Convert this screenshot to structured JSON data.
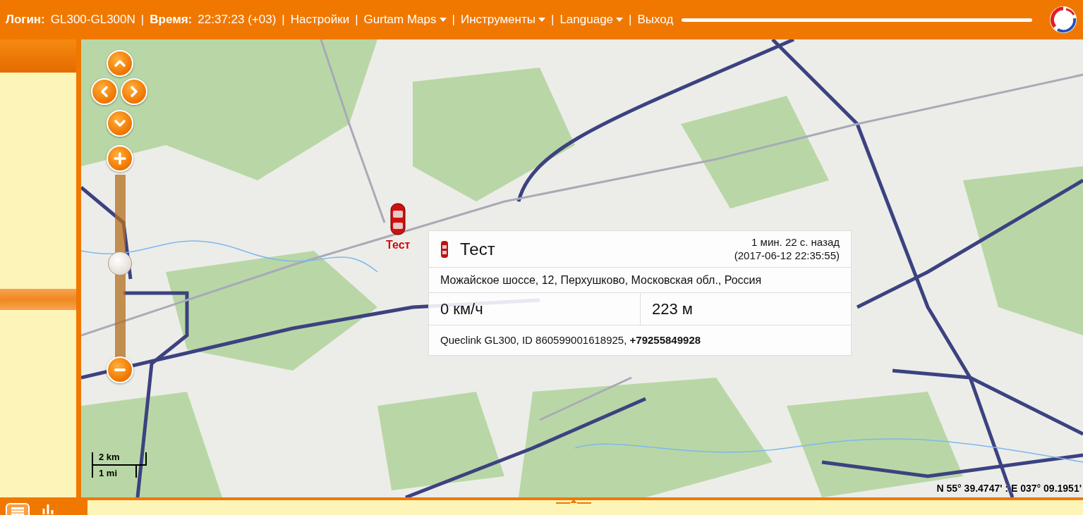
{
  "topbar": {
    "login_label": "Логин:",
    "login": "GL300-GL300N",
    "separator": "|",
    "time_label": "Время:",
    "time": "22:37:23 (+03)",
    "menu": [
      {
        "label": "Настройки",
        "dropdown": false
      },
      {
        "label": "Gurtam Maps",
        "dropdown": true
      },
      {
        "label": "Инструменты",
        "dropdown": true
      },
      {
        "label": "Language",
        "dropdown": true
      },
      {
        "label": "Выход",
        "dropdown": false
      }
    ]
  },
  "map": {
    "zoom": {
      "level": 0.52
    },
    "marker": {
      "label": "Тест"
    },
    "popup": {
      "title": "Тест",
      "ago": "1 мин. 22 с. назад",
      "timestamp": "(2017-06-12 22:35:55)",
      "address": "Можайское шоссе, 12, Перхушково, Московская обл., Россия",
      "speed": "0 км/ч",
      "altitude": "223 м",
      "device": "Queclink GL300, ID 860599001618925, **+79255849928**"
    },
    "scale": {
      "metric": "2 km",
      "imperial": "1 mi"
    },
    "coordinates": "N 55° 39.4747' : E 037° 09.1951'"
  }
}
